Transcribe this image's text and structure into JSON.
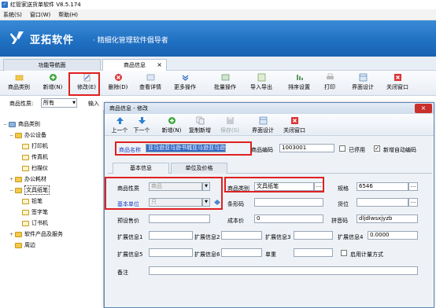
{
  "window": {
    "title": "红管家送货单软件 V8.5.174"
  },
  "menu": [
    {
      "label": "系统(S)"
    },
    {
      "label": "窗口(W)"
    },
    {
      "label": "帮助(H)"
    }
  ],
  "banner": {
    "brand": "亚拓软件",
    "slogan": "精细化管理软件倡导者"
  },
  "tabs": [
    {
      "label": "功能导航面"
    },
    {
      "label": "商品信息"
    }
  ],
  "toolbar": [
    {
      "label": "商品类别",
      "icon": "folder-icon"
    },
    {
      "label": "新增(N)",
      "icon": "add-icon"
    },
    {
      "label": "修改(E)",
      "icon": "edit-icon"
    },
    {
      "label": "删除(D)",
      "icon": "delete-icon"
    },
    {
      "label": "查看详情",
      "icon": "view-icon"
    },
    {
      "label": "更多操作",
      "icon": "more-icon"
    },
    {
      "label": "批量操作",
      "icon": "batch-icon"
    },
    {
      "label": "导入导出",
      "icon": "import-export-icon"
    },
    {
      "label": "排序设置",
      "icon": "sort-icon"
    },
    {
      "label": "打印",
      "icon": "print-icon"
    },
    {
      "label": "界面设计",
      "icon": "layout-icon"
    },
    {
      "label": "关闭窗口",
      "icon": "close-window-icon"
    }
  ],
  "filter": {
    "label": "商品性质:",
    "value": "所有",
    "input_label": "输入"
  },
  "tree": [
    {
      "label": "商品类别",
      "level": 0,
      "toggle": "−"
    },
    {
      "label": "办公设备",
      "level": 1,
      "toggle": "−"
    },
    {
      "label": "打印机",
      "level": 2,
      "toggle": ""
    },
    {
      "label": "传真机",
      "level": 2,
      "toggle": ""
    },
    {
      "label": "扫描仪",
      "level": 2,
      "toggle": ""
    },
    {
      "label": "办公耗材",
      "level": 1,
      "toggle": "+"
    },
    {
      "label": "文具纸笔",
      "level": 1,
      "toggle": "−"
    },
    {
      "label": "铅笔",
      "level": 2,
      "toggle": ""
    },
    {
      "label": "签字笔",
      "level": 2,
      "toggle": ""
    },
    {
      "label": "订书机",
      "level": 2,
      "toggle": ""
    },
    {
      "label": "软件产品及服务",
      "level": 1,
      "toggle": "+"
    },
    {
      "label": "周边",
      "level": 1,
      "toggle": ""
    }
  ],
  "dialog": {
    "title": "商品信息 - 修改",
    "close_symbol": "×",
    "toolbar": [
      {
        "label": "上一个",
        "icon": "arrow-up-icon"
      },
      {
        "label": "下一个",
        "icon": "arrow-down-icon"
      },
      {
        "label": "新增(N)",
        "icon": "add-icon"
      },
      {
        "label": "复制新增",
        "icon": "copy-add-icon"
      },
      {
        "label": "保存(S)",
        "icon": "save-icon"
      },
      {
        "label": "界面设计",
        "icon": "layout-icon"
      },
      {
        "label": "关闭窗口",
        "icon": "close-window-icon"
      }
    ],
    "fields": {
      "name_label": "商品名称",
      "name_value": "亚马逊亚马逊书城亚马逊亚马逊书城",
      "code_label": "商品编码",
      "code_value": "1003001",
      "disabled_label": "已停用",
      "auto_code_label": "新增自动编码",
      "nature_label": "商品性质",
      "nature_value": "商品",
      "category_label": "商品类别",
      "category_value": "文具纸笔",
      "spec_label": "规格",
      "spec_value": "6546",
      "unit_label": "基本单位",
      "unit_value": "只",
      "barcode_label": "条形码",
      "barcode_value": "",
      "location_label": "货位",
      "location_value": "",
      "preset_price_label": "预设售价",
      "preset_price_value": "",
      "cost_label": "成本价",
      "cost_value": "0",
      "pinyin_label": "拼音码",
      "pinyin_value": "dljdlwsxjyzb",
      "ext1_label": "扩展信息1",
      "ext1_value": "",
      "ext2_label": "扩展信息2",
      "ext2_value": "",
      "ext3_label": "扩展信息3",
      "ext3_value": "",
      "ext4_label": "扩展信息4",
      "ext4_value": "0.0000",
      "ext5_label": "扩展信息5",
      "ext5_value": "",
      "ext6_label": "扩展信息6",
      "ext6_value": "",
      "weight_label": "单重",
      "weight_value": "",
      "measure_label": "启用计量方式",
      "remark_label": "备注",
      "remark_value": "",
      "ellipsis": "..."
    },
    "inner_tabs": [
      {
        "label": "基本信息"
      },
      {
        "label": "单位及价格"
      }
    ]
  },
  "colors": {
    "banner": "#1f6fc2",
    "highlight_box": "#e02020",
    "selection": "#316ac5"
  }
}
